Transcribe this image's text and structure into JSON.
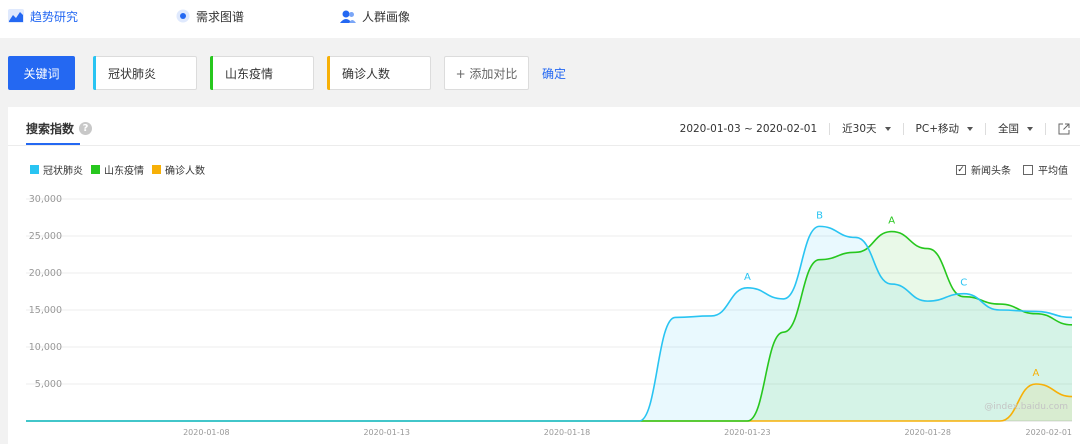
{
  "nav": {
    "tabs": [
      {
        "label": "趋势研究",
        "icon": "trend-icon",
        "active": true
      },
      {
        "label": "需求图谱",
        "icon": "demand-graph-icon",
        "active": false
      },
      {
        "label": "人群画像",
        "icon": "people-icon",
        "active": false
      }
    ]
  },
  "keywords": {
    "primary_label": "关键词",
    "items": [
      {
        "label": "冠状肺炎",
        "color": "#29c4f2"
      },
      {
        "label": "山东疫情",
        "color": "#27c71e"
      },
      {
        "label": "确诊人数",
        "color": "#f7b007"
      }
    ],
    "add_label": "+ 添加对比",
    "confirm_label": "确定"
  },
  "panel": {
    "title": "搜索指数",
    "help_icon_text": "?",
    "date_range": "2020-01-03 ~ 2020-02-01",
    "period": "近30天",
    "device": "PC+移动",
    "region": "全国",
    "export_icon": "external-link-icon"
  },
  "options": [
    {
      "label": "新闻头条",
      "checked": true
    },
    {
      "label": "平均值",
      "checked": false
    }
  ],
  "watermark": "@index.baidu.com",
  "colors": {
    "accent": "#2468f2",
    "grid": "#ececec"
  },
  "chart_data": {
    "type": "area",
    "x": [
      "2020-01-03",
      "2020-01-04",
      "2020-01-05",
      "2020-01-06",
      "2020-01-07",
      "2020-01-08",
      "2020-01-09",
      "2020-01-10",
      "2020-01-11",
      "2020-01-12",
      "2020-01-13",
      "2020-01-14",
      "2020-01-15",
      "2020-01-16",
      "2020-01-17",
      "2020-01-18",
      "2020-01-19",
      "2020-01-20",
      "2020-01-21",
      "2020-01-22",
      "2020-01-23",
      "2020-01-24",
      "2020-01-25",
      "2020-01-26",
      "2020-01-27",
      "2020-01-28",
      "2020-01-29",
      "2020-01-30",
      "2020-01-31",
      "2020-02-01"
    ],
    "x_tick_labels": [
      "2020-01-08",
      "2020-01-13",
      "2020-01-18",
      "2020-01-23",
      "2020-01-28",
      "2020-02-01"
    ],
    "x_tick_indices": [
      5,
      10,
      15,
      20,
      25,
      29
    ],
    "y_ticks": [
      "30,000",
      "25,000",
      "20,000",
      "15,000",
      "10,000",
      "5,000"
    ],
    "y_tick_values": [
      30000,
      25000,
      20000,
      15000,
      10000,
      5000
    ],
    "ylim": [
      0,
      30000
    ],
    "grid": true,
    "legend": "top-left",
    "series": [
      {
        "name": "冠状肺炎",
        "color": "#29c4f2",
        "values": [
          0,
          0,
          0,
          0,
          0,
          0,
          0,
          0,
          0,
          0,
          0,
          0,
          0,
          0,
          0,
          0,
          0,
          0,
          14000,
          14200,
          18000,
          16500,
          26300,
          24800,
          18500,
          16200,
          17200,
          15000,
          14800,
          14000
        ]
      },
      {
        "name": "山东疫情",
        "color": "#27c71e",
        "values": [
          0,
          0,
          0,
          0,
          0,
          0,
          0,
          0,
          0,
          0,
          0,
          0,
          0,
          0,
          0,
          0,
          0,
          0,
          0,
          0,
          0,
          12000,
          21800,
          22800,
          25600,
          23300,
          16800,
          15800,
          14500,
          13000
        ]
      },
      {
        "name": "确诊人数",
        "color": "#f7b007",
        "values": [
          0,
          0,
          0,
          0,
          0,
          0,
          0,
          0,
          0,
          0,
          0,
          0,
          0,
          0,
          0,
          0,
          0,
          0,
          0,
          0,
          0,
          0,
          0,
          0,
          0,
          0,
          0,
          0,
          5000,
          3300
        ]
      }
    ],
    "annotations": [
      {
        "series": 0,
        "index": 20,
        "label": "A"
      },
      {
        "series": 0,
        "index": 22,
        "label": "B"
      },
      {
        "series": 1,
        "index": 24,
        "label": "A"
      },
      {
        "series": 0,
        "index": 26,
        "label": "C"
      },
      {
        "series": 2,
        "index": 28,
        "label": "A"
      }
    ]
  }
}
